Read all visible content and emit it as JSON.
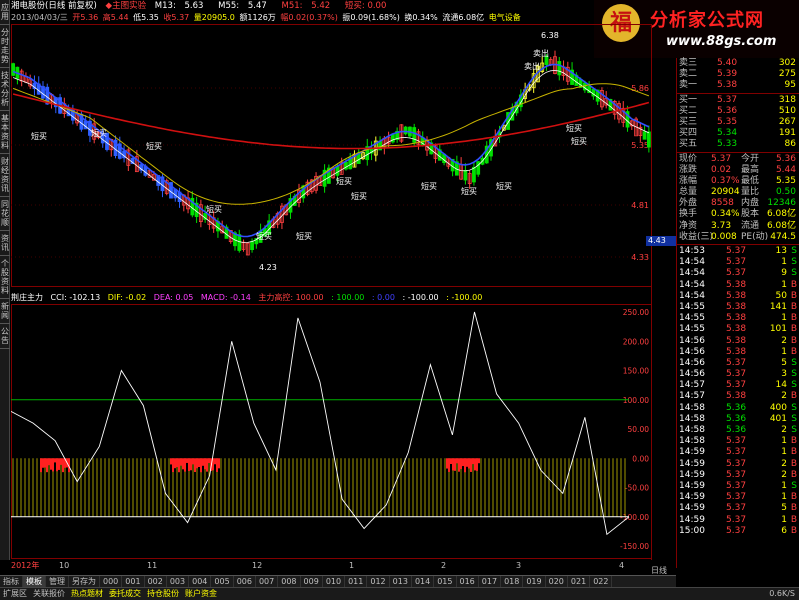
{
  "left_tabs": [
    "应用",
    "分时走势",
    "技术分析",
    "基本资料",
    "财经资讯",
    "同花顺",
    "资讯",
    "个股资料",
    "新闻",
    "公告"
  ],
  "title": {
    "stock": "湘电股份(日线 前复权)",
    "indicator": "◆主图实验",
    "m13_label": "M13:",
    "m13": "5.63",
    "m55_label": "M55:",
    "m55": "5.47",
    "m51_label": "M51:",
    "m51": "5.42",
    "short_sell": "短买: 0.00"
  },
  "info": {
    "date": "2013/04/03/三",
    "open": "开5.36",
    "high": "高5.44",
    "low": "低5.35",
    "close": "收5.37",
    "volume": "量20905.0",
    "amount": "额1126万",
    "change": "幅0.02(0.37%)",
    "amplitude": "振0.09(1.68%)",
    "turnover": "换0.34%",
    "float": "流通6.08亿",
    "sector": "电气设备"
  },
  "price_axis": [
    "5.86",
    "5.35",
    "4.81",
    "4.33"
  ],
  "current_price_tag": "4.43",
  "annotations": [
    {
      "text": "短买"
    },
    {
      "text": "短买"
    },
    {
      "text": "短买"
    },
    {
      "text": "短买"
    },
    {
      "text": "短买"
    },
    {
      "text": "短买"
    },
    {
      "text": "短买"
    },
    {
      "text": "短买"
    },
    {
      "text": "短买"
    },
    {
      "text": "短买"
    },
    {
      "text": "短买"
    },
    {
      "text": "短买"
    },
    {
      "text": "短买"
    },
    {
      "text": "卖出"
    },
    {
      "text": "卖出"
    },
    {
      "text": "4.23"
    },
    {
      "text": "6.38"
    }
  ],
  "indicator_header": {
    "name": "荆庄主力",
    "cci": "CCI: -102.13",
    "dif": "DIF: -0.02",
    "dea": "DEA: 0.05",
    "macd": "MACD: -0.14",
    "zl": "主力高控: 100.00",
    "v1": ": 100.00",
    "v2": ": 0.00",
    "v3": ": -100.00",
    "v4": ": -100.00"
  },
  "cci_axis": [
    "250.00",
    "200.00",
    "150.00",
    "100.00",
    "50.00",
    "0.00",
    "-50.00",
    "-100.00",
    "-150.00"
  ],
  "x_axis": [
    "2012年",
    "10",
    "11",
    "12",
    "1",
    "2",
    "3",
    "4"
  ],
  "period": "日线",
  "chart_data": {
    "type": "line",
    "series": [
      {
        "name": "CCI",
        "values": [
          80,
          60,
          30,
          -40,
          20,
          150,
          90,
          -60,
          -110,
          -30,
          200,
          60,
          -20,
          240,
          130,
          -70,
          -120,
          -80,
          10,
          160,
          40,
          250,
          110,
          60,
          -20,
          -60,
          70,
          -130,
          -100
        ]
      }
    ],
    "ylim": [
      -180,
      260
    ]
  },
  "orderbook": {
    "asks": [
      {
        "label": "卖三",
        "price": "5.40",
        "vol": "302"
      },
      {
        "label": "卖二",
        "price": "5.39",
        "vol": "275"
      },
      {
        "label": "卖一",
        "price": "5.38",
        "vol": "95"
      }
    ],
    "bids": [
      {
        "label": "买一",
        "price": "5.37",
        "vol": "318"
      },
      {
        "label": "买二",
        "price": "5.36",
        "vol": "510"
      },
      {
        "label": "买三",
        "price": "5.35",
        "vol": "267"
      },
      {
        "label": "买四",
        "price": "5.34",
        "vol": "191"
      },
      {
        "label": "买五",
        "price": "5.33",
        "vol": "86"
      }
    ]
  },
  "stats": [
    {
      "l1": "现价",
      "v1": "5.37",
      "c1": "red",
      "l2": "今开",
      "v2": "5.36",
      "c2": "red"
    },
    {
      "l1": "涨跌",
      "v1": "0.02",
      "c1": "red",
      "l2": "最高",
      "v2": "5.44",
      "c2": "red"
    },
    {
      "l1": "涨幅",
      "v1": "0.37%",
      "c1": "red",
      "l2": "最低",
      "v2": "5.35",
      "c2": "yellow"
    },
    {
      "l1": "总量",
      "v1": "20904",
      "c1": "yellow",
      "l2": "量比",
      "v2": "0.50",
      "c2": "green"
    },
    {
      "l1": "外盘",
      "v1": "8558",
      "c1": "red",
      "l2": "内盘",
      "v2": "12346",
      "c2": "green"
    },
    {
      "l1": "换手",
      "v1": "0.34%",
      "c1": "yellow",
      "l2": "股本",
      "v2": "6.08亿",
      "c2": "yellow"
    },
    {
      "l1": "净资",
      "v1": "3.73",
      "c1": "yellow",
      "l2": "流通",
      "v2": "6.08亿",
      "c2": "yellow"
    },
    {
      "l1": "收益(三)",
      "v1": "0.008",
      "c1": "yellow",
      "l2": "PE(动)",
      "v2": "474.5",
      "c2": "yellow"
    }
  ],
  "ticks": [
    {
      "time": "14:53",
      "price": "5.37",
      "vol": "13",
      "side": "S"
    },
    {
      "time": "14:54",
      "price": "5.37",
      "vol": "1",
      "side": "S"
    },
    {
      "time": "14:54",
      "price": "5.37",
      "vol": "9",
      "side": "S"
    },
    {
      "time": "14:54",
      "price": "5.38",
      "vol": "1",
      "side": "B"
    },
    {
      "time": "14:54",
      "price": "5.38",
      "vol": "50",
      "side": "B"
    },
    {
      "time": "14:55",
      "price": "5.38",
      "vol": "141",
      "side": "B"
    },
    {
      "time": "14:55",
      "price": "5.38",
      "vol": "1",
      "side": "B"
    },
    {
      "time": "14:55",
      "price": "5.38",
      "vol": "101",
      "side": "B"
    },
    {
      "time": "14:56",
      "price": "5.38",
      "vol": "2",
      "side": "B"
    },
    {
      "time": "14:56",
      "price": "5.38",
      "vol": "1",
      "side": "B"
    },
    {
      "time": "14:56",
      "price": "5.37",
      "vol": "5",
      "side": "S"
    },
    {
      "time": "14:56",
      "price": "5.37",
      "vol": "3",
      "side": "S"
    },
    {
      "time": "14:57",
      "price": "5.37",
      "vol": "14",
      "side": "S"
    },
    {
      "time": "14:57",
      "price": "5.38",
      "vol": "2",
      "side": "B"
    },
    {
      "time": "14:58",
      "price": "5.36",
      "vol": "400",
      "side": "S"
    },
    {
      "time": "14:58",
      "price": "5.36",
      "vol": "401",
      "side": "S"
    },
    {
      "time": "14:58",
      "price": "5.36",
      "vol": "2",
      "side": "S"
    },
    {
      "time": "14:58",
      "price": "5.37",
      "vol": "1",
      "side": "B"
    },
    {
      "time": "14:59",
      "price": "5.37",
      "vol": "1",
      "side": "B"
    },
    {
      "time": "14:59",
      "price": "5.37",
      "vol": "2",
      "side": "B"
    },
    {
      "time": "14:59",
      "price": "5.37",
      "vol": "2",
      "side": "B"
    },
    {
      "time": "14:59",
      "price": "5.37",
      "vol": "1",
      "side": "S"
    },
    {
      "time": "14:59",
      "price": "5.37",
      "vol": "1",
      "side": "B"
    },
    {
      "time": "14:59",
      "price": "5.37",
      "vol": "5",
      "side": "B"
    },
    {
      "time": "14:59",
      "price": "5.37",
      "vol": "1",
      "side": "B"
    },
    {
      "time": "15:00",
      "price": "5.37",
      "vol": "6",
      "side": "B"
    }
  ],
  "bottom_tabs": [
    "指标",
    "模板",
    "管理",
    "另存为",
    "000",
    "001",
    "002",
    "003",
    "004",
    "005",
    "006",
    "007",
    "008",
    "009",
    "010",
    "011",
    "012",
    "013",
    "014",
    "015",
    "016",
    "017",
    "018",
    "019",
    "020",
    "021",
    "022"
  ],
  "status": [
    "扩展区",
    "关联报价",
    "热点题材",
    "委托成交",
    "持仓股份",
    "账户资金"
  ],
  "status_right": "0.6K/S",
  "colors": {
    "up": "#ff4040",
    "down": "#00e000",
    "ma_red": "#d01010",
    "ma_yellow": "#c8b400",
    "ma_blue": "#3050ff",
    "grid": "#800000"
  }
}
